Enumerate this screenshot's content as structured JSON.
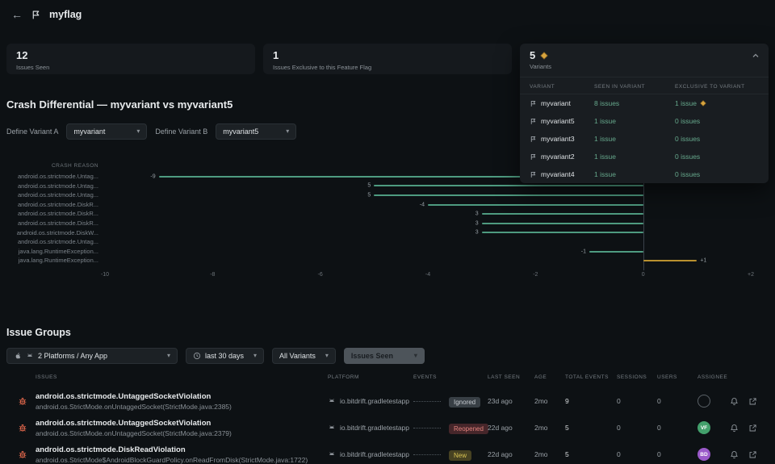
{
  "colors": {
    "accent_link": "#66a88c",
    "bar_negative": "#4e9b80",
    "bar_positive": "#b9912f",
    "diamond": "#d7a43f",
    "avatar_green": "#43a06c",
    "avatar_purple": "#9a59c9"
  },
  "topbar": {
    "back": "←",
    "title": "myflag"
  },
  "stats": {
    "issues_seen": {
      "value": "12",
      "label": "Issues Seen"
    },
    "exclusive": {
      "value": "1",
      "label": "Issues Exclusive to this Feature Flag"
    }
  },
  "variants_panel": {
    "value": "5",
    "label": "Variants",
    "columns": {
      "variant": "Variant",
      "seen": "Seen in variant",
      "exclusive": "Exclusive to variant"
    },
    "rows": [
      {
        "name": "myvariant",
        "seen": "8 issues",
        "exclusive": "1 issue",
        "diamond": true
      },
      {
        "name": "myvariant5",
        "seen": "1 issue",
        "exclusive": "0 issues",
        "diamond": false
      },
      {
        "name": "myvariant3",
        "seen": "1 issue",
        "exclusive": "0 issues",
        "diamond": false
      },
      {
        "name": "myvariant2",
        "seen": "1 issue",
        "exclusive": "0 issues",
        "diamond": false
      },
      {
        "name": "myvariant4",
        "seen": "1 issue",
        "exclusive": "0 issues",
        "diamond": false
      }
    ]
  },
  "crash_differential": {
    "title": "Crash Differential — myvariant vs myvariant5",
    "variant_a": {
      "label": "Define Variant A",
      "value": "myvariant"
    },
    "variant_b": {
      "label": "Define Variant B",
      "value": "myvariant5"
    }
  },
  "chart_data": {
    "type": "bar",
    "orientation": "horizontal",
    "column_header": "Crash Reason",
    "xlim": [
      -10,
      2
    ],
    "x_ticks": [
      {
        "label": "-10",
        "value": -10
      },
      {
        "label": "-8",
        "value": -8
      },
      {
        "label": "-6",
        "value": -6
      },
      {
        "label": "-4",
        "value": -4
      },
      {
        "label": "-2",
        "value": -2
      },
      {
        "label": "0",
        "value": 0
      },
      {
        "label": "+2",
        "value": 2
      }
    ],
    "points": [
      {
        "category": "android.os.strictmode.Untag...",
        "value": -9,
        "label": "-9"
      },
      {
        "category": "android.os.strictmode.Untag...",
        "value": -5,
        "label": "5"
      },
      {
        "category": "android.os.strictmode.Untag...",
        "value": -5,
        "label": "5"
      },
      {
        "category": "android.os.strictmode.DiskR...",
        "value": -4,
        "label": "-4"
      },
      {
        "category": "android.os.strictmode.DiskR...",
        "value": -3,
        "label": "3"
      },
      {
        "category": "android.os.strictmode.DiskR...",
        "value": -3,
        "label": "3"
      },
      {
        "category": "android.os.strictmode.DiskW...",
        "value": -3,
        "label": "3"
      },
      {
        "category": "android.os.strictmode.Untag...",
        "value": 0,
        "label": ""
      },
      {
        "category": "java.lang.RuntimeException...",
        "value": -1,
        "label": "-1"
      },
      {
        "category": "java.lang.RuntimeException...",
        "value": 1,
        "label": "+1"
      }
    ]
  },
  "issue_groups": {
    "title": "Issue Groups",
    "filters": {
      "platforms": {
        "value": "2 Platforms / Any App"
      },
      "time_range": {
        "value": "last 30 days"
      },
      "variants": {
        "value": "All Variants"
      },
      "metric": {
        "value": "Issues Seen"
      }
    },
    "columns": [
      "Issues",
      "Platform",
      "Events",
      "Last Seen",
      "Age",
      "Total Events",
      "Sessions",
      "Users",
      "Assignee"
    ],
    "rows": [
      {
        "title": "android.os.strictmode.UntaggedSocketViolation",
        "subtitle": "android.os.StrictMode.onUntaggedSocket(StrictMode.java:2385)",
        "platform": "io.bitdrift.gradletestapp",
        "status": "Ignored",
        "status_type": "ignored",
        "last_seen": "23d ago",
        "age": "2mo",
        "total_events": "9",
        "sessions": "0",
        "users": "0",
        "assignee": "",
        "avatar_color": ""
      },
      {
        "title": "android.os.strictmode.UntaggedSocketViolation",
        "subtitle": "android.os.StrictMode.onUntaggedSocket(StrictMode.java:2379)",
        "platform": "io.bitdrift.gradletestapp",
        "status": "Reopened",
        "status_type": "reopened",
        "last_seen": "22d ago",
        "age": "2mo",
        "total_events": "5",
        "sessions": "0",
        "users": "0",
        "assignee": "VF",
        "avatar_color": "#43a06c"
      },
      {
        "title": "android.os.strictmode.DiskReadViolation",
        "subtitle": "android.os.StrictMode$AndroidBlockGuardPolicy.onReadFromDisk(StrictMode.java:1722)",
        "platform": "io.bitdrift.gradletestapp",
        "status": "New",
        "status_type": "new",
        "last_seen": "22d ago",
        "age": "2mo",
        "total_events": "5",
        "sessions": "0",
        "users": "0",
        "assignee": "BD",
        "avatar_color": "#9a59c9"
      }
    ]
  }
}
